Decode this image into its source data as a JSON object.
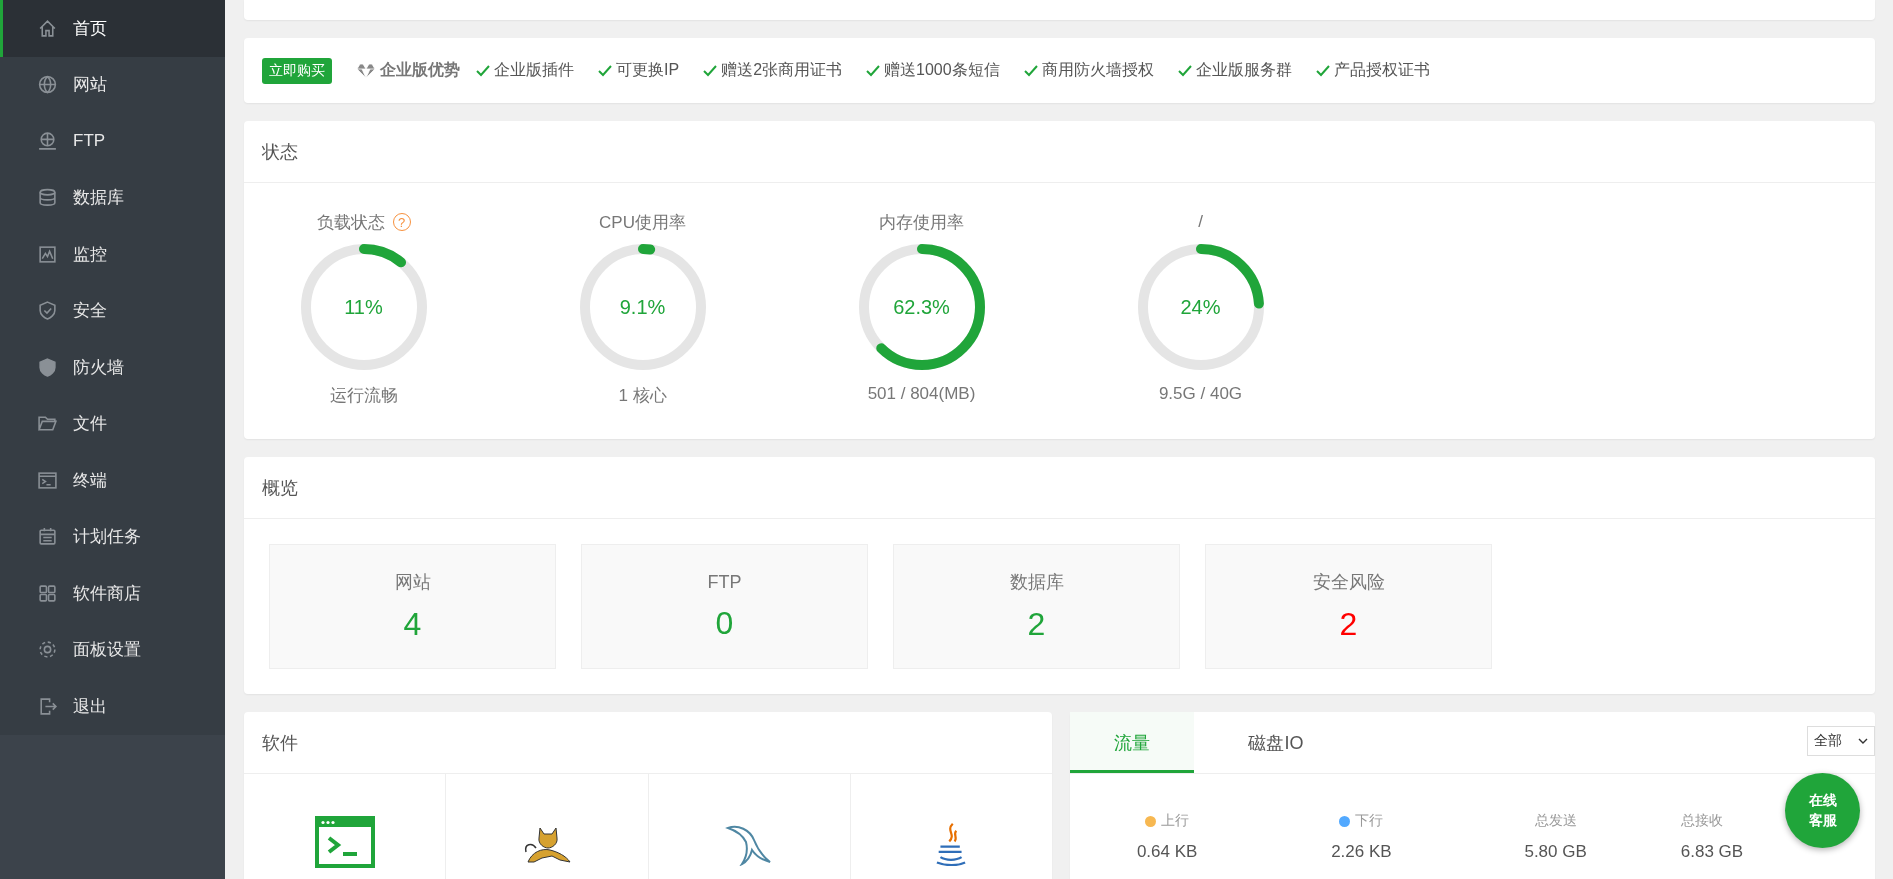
{
  "sidebar": {
    "items": [
      {
        "label": "首页",
        "selected": true
      },
      {
        "label": "网站",
        "selected": false
      },
      {
        "label": "FTP",
        "selected": false
      },
      {
        "label": "数据库",
        "selected": false
      },
      {
        "label": "监控",
        "selected": false
      },
      {
        "label": "安全",
        "selected": false
      },
      {
        "label": "防火墙",
        "selected": false
      },
      {
        "label": "文件",
        "selected": false
      },
      {
        "label": "终端",
        "selected": false
      },
      {
        "label": "计划任务",
        "selected": false
      },
      {
        "label": "软件商店",
        "selected": false
      },
      {
        "label": "面板设置",
        "selected": false
      },
      {
        "label": "退出",
        "selected": false
      }
    ]
  },
  "promo": {
    "button": "立即购买",
    "title": "企业版优势",
    "features": [
      "企业版插件",
      "可更换IP",
      "赠送2张商用证书",
      "赠送1000条短信",
      "商用防火墙授权",
      "企业版服务群",
      "产品授权证书"
    ]
  },
  "status": {
    "title": "状态",
    "help": "?",
    "gauges": [
      {
        "label": "负载状态",
        "value": "11%",
        "sub": "运行流畅",
        "level": 0.11,
        "help": true
      },
      {
        "label": "CPU使用率",
        "value": "9.1%",
        "sub": "1 核心",
        "level": 0.02,
        "help": false
      },
      {
        "label": "内存使用率",
        "value": "62.3%",
        "sub": "501 / 804(MB)",
        "level": 0.623,
        "help": false
      },
      {
        "label": "/",
        "value": "24%",
        "sub": "9.5G / 40G",
        "level": 0.24,
        "help": false
      }
    ]
  },
  "overview": {
    "title": "概览",
    "items": [
      {
        "label": "网站",
        "value": "4",
        "color": "#20a53a"
      },
      {
        "label": "FTP",
        "value": "0",
        "color": "#20a53a"
      },
      {
        "label": "数据库",
        "value": "2",
        "color": "#20a53a"
      },
      {
        "label": "安全风险",
        "value": "2",
        "color": "#ff0000"
      }
    ]
  },
  "software": {
    "title": "软件",
    "items": [
      {
        "kind": "terminal"
      },
      {
        "kind": "tomcat"
      },
      {
        "kind": "mysql"
      },
      {
        "kind": "java"
      }
    ]
  },
  "traffic": {
    "tabs": [
      {
        "label": "流量",
        "selected": true
      },
      {
        "label": "磁盘IO",
        "selected": false
      }
    ],
    "select": "全部",
    "stats": [
      {
        "label": "上行",
        "value": "0.64 KB",
        "color": "#f7b851"
      },
      {
        "label": "下行",
        "value": "2.26 KB",
        "color": "#52a9ff"
      },
      {
        "label": "总发送",
        "value": "5.80 GB"
      },
      {
        "label": "总接收",
        "value": "6.83 GB"
      }
    ]
  },
  "chat_button": [
    "在线",
    "客服"
  ]
}
